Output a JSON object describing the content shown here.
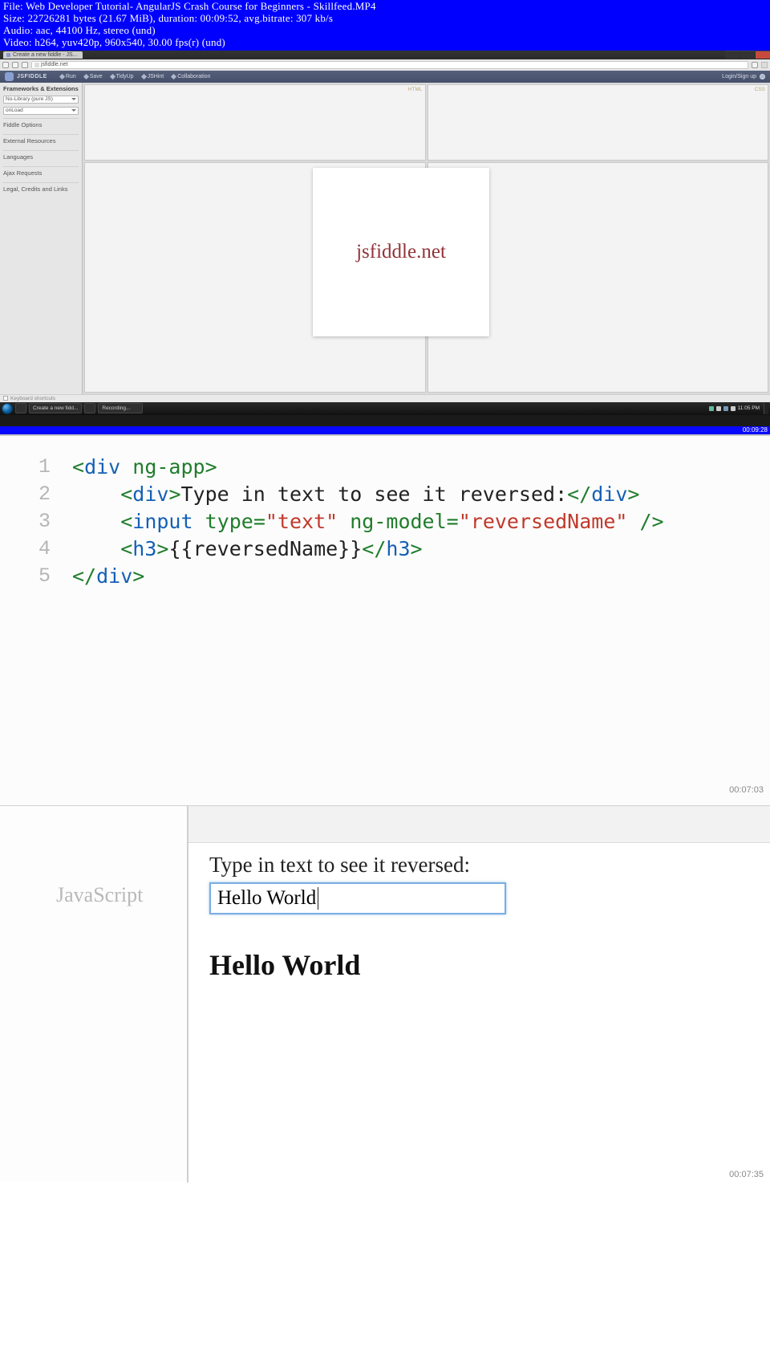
{
  "player": {
    "file": "File: Web Developer Tutorial- AngularJS Crash Course for Beginners - Skillfeed.MP4",
    "size": "Size: 22726281 bytes (21.67 MiB), duration: 00:09:52, avg.bitrate: 307 kb/s",
    "audio": "Audio: aac, 44100 Hz, stereo (und)",
    "video": "Video: h264, yuv420p, 960x540, 30.00 fps(r) (und)",
    "timestamp1": "00:09:28",
    "timestamp2": "00:07:03",
    "timestamp3": "00:07:35"
  },
  "tab": {
    "title": "Create a new fiddle - JS..."
  },
  "address": "jsfiddle.net",
  "jsfiddle": {
    "brand": "JSFIDDLE",
    "actions": {
      "run": "Run",
      "save": "Save",
      "tidy": "TidyUp",
      "jshint": "JSHint",
      "collab": "Collaboration"
    },
    "login": "Login/Sign up",
    "pane_tags": {
      "html": "HTML",
      "css": "CSS"
    },
    "status": "Keyboard shortcuts"
  },
  "sidebar": {
    "title": "Frameworks & Extensions",
    "selLib": "No-Library (pure JS)",
    "selWrap": "onLoad",
    "items": [
      "Fiddle Options",
      "External Resources",
      "Languages",
      "Ajax Requests",
      "Legal, Credits and Links"
    ]
  },
  "overlay": {
    "text": "jsfiddle.net"
  },
  "taskbar": {
    "item1": "Create a new fidd...",
    "item2": "Recording...",
    "time": "11:05 PM"
  },
  "code": {
    "lines": [
      "1",
      "2",
      "3",
      "4",
      "5"
    ],
    "l1a": "<",
    "l1b": "div",
    "l1c": " ng-app",
    "l1d": ">",
    "l2a": "<",
    "l2b": "div",
    "l2c": ">",
    "l2d": "Type in text to see it reversed:",
    "l2e": "</",
    "l2f": "div",
    "l2g": ">",
    "l3a": "<",
    "l3b": "input",
    "l3c": " type",
    "l3d": "=",
    "l3e": "\"text\"",
    "l3f": " ng-model",
    "l3g": "=",
    "l3h": "\"reversedName\"",
    "l3i": " />",
    "l4a": "<",
    "l4b": "h3",
    "l4c": ">",
    "l4d": "{{reversedName}}",
    "l4e": "</",
    "l4f": "h3",
    "l4g": ">",
    "l5a": "</",
    "l5b": "div",
    "l5c": ">"
  },
  "result": {
    "jsTab": "JavaScript",
    "prompt": "Type in text to see it reversed:",
    "inputValue": "Hello World",
    "bound": "Hello World"
  }
}
